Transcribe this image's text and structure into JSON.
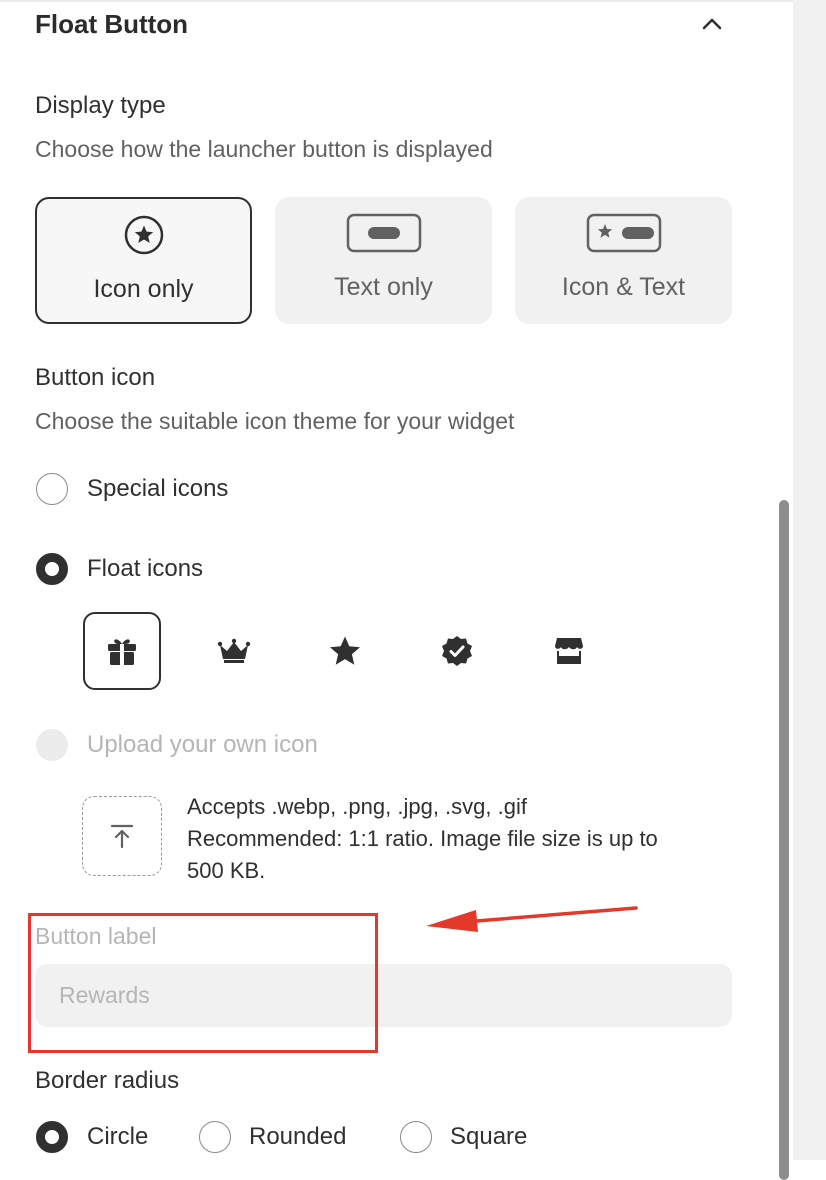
{
  "section": {
    "title": "Float Button"
  },
  "display_type": {
    "label": "Display type",
    "help": "Choose how the launcher button is displayed",
    "options": [
      {
        "label": "Icon only",
        "icon": "circled-star-icon",
        "selected": true
      },
      {
        "label": "Text only",
        "icon": "text-pill-icon",
        "selected": false
      },
      {
        "label": "Icon & Text",
        "icon": "star-pill-icon",
        "selected": false
      }
    ]
  },
  "button_icon": {
    "label": "Button icon",
    "help": "Choose the suitable icon theme for your widget",
    "radios": [
      {
        "label": "Special icons",
        "state": "unchecked"
      },
      {
        "label": "Float icons",
        "state": "checked"
      },
      {
        "label": "Upload your own icon",
        "state": "disabled"
      }
    ],
    "float_icons": [
      "gift-icon",
      "crown-icon",
      "star-icon",
      "verified-badge-icon",
      "store-icon"
    ],
    "upload": {
      "accepts": "Accepts .webp, .png, .jpg, .svg, .gif",
      "recommend_line1": "Recommended: 1:1 ratio. Image file size is up to",
      "recommend_line2": "500 KB."
    }
  },
  "button_label": {
    "label": "Button label",
    "value": "Rewards"
  },
  "border_radius": {
    "label": "Border radius",
    "options": [
      {
        "label": "Circle",
        "state": "checked"
      },
      {
        "label": "Rounded",
        "state": "unchecked"
      },
      {
        "label": "Square",
        "state": "unchecked"
      }
    ]
  },
  "colors": {
    "text": "#303030",
    "muted": "#616161",
    "disabled": "#b5b5b5",
    "annotation": "#e2392b"
  }
}
